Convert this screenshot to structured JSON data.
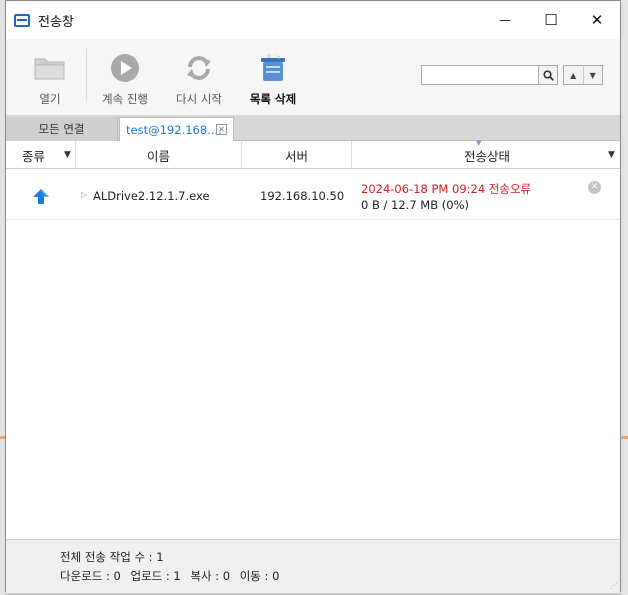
{
  "window": {
    "title": "전송창",
    "controls": {
      "minimize": "—",
      "maximize": "☐",
      "close": "✕"
    }
  },
  "toolbar": {
    "open_label": "열기",
    "resume_label": "계속 진행",
    "restart_label": "다시 시작",
    "delete_label": "목록 삭제",
    "search": {
      "value": "",
      "placeholder": ""
    }
  },
  "tabs": [
    {
      "label": "모든 연결",
      "active": false
    },
    {
      "label": "test@192.168....",
      "active": true
    }
  ],
  "columns": {
    "type": "종류",
    "name": "이름",
    "server": "서버",
    "status": "전송상태"
  },
  "rows": [
    {
      "direction": "upload",
      "name": "ALDrive2.12.1.7.exe",
      "server": "192.168.10.50",
      "status": "2024-06-18 PM 09:24 전송오류",
      "progress": "0 B / 12.7 MB (0%)"
    }
  ],
  "status_bar": {
    "total": "전체 전송 작업 수 : 1",
    "download": "다운로드 : 0",
    "upload": "업로드 : 1",
    "copy": "복사 : 0",
    "move": "이동 : 0"
  },
  "colors": {
    "accent": "#1f78d1",
    "error": "#cc1f1f",
    "upload_arrow": "#1a7fd9"
  }
}
